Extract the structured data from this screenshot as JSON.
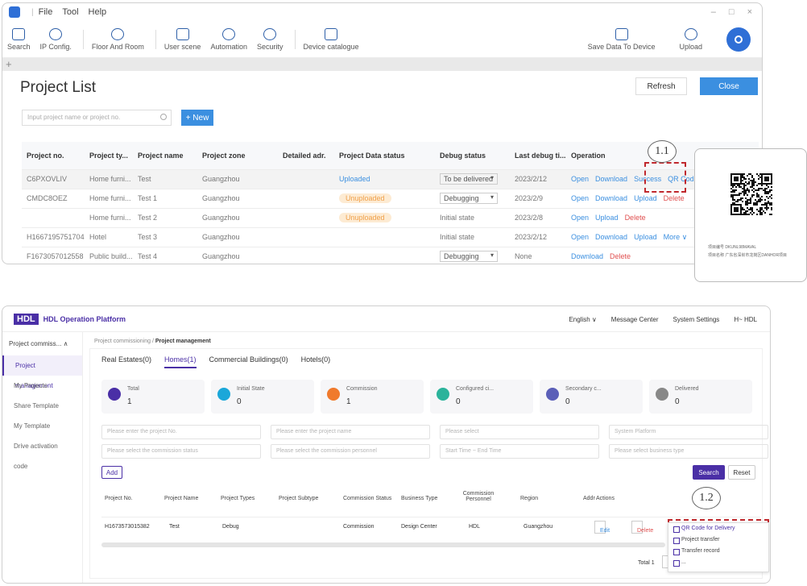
{
  "window1": {
    "menu": [
      "File",
      "Tool",
      "Help"
    ],
    "window_controls": [
      "–",
      "□",
      "×"
    ],
    "toolbar_left": [
      {
        "label": "Search",
        "icon": "search-icon"
      },
      {
        "label": "IP Config.",
        "icon": "ip-config-icon"
      },
      {
        "label": "Floor And Room",
        "icon": "floor-icon"
      },
      {
        "label": "User scene",
        "icon": "user-scene-icon"
      },
      {
        "label": "Automation",
        "icon": "automation-icon"
      },
      {
        "label": "Security",
        "icon": "security-icon"
      },
      {
        "label": "Device catalogue",
        "icon": "device-catalogue-icon"
      }
    ],
    "toolbar_right": [
      {
        "label": "Save Data To Device",
        "icon": "save-icon"
      },
      {
        "label": "Upload",
        "icon": "upload-icon"
      }
    ],
    "tab_plus": "+",
    "title": "Project List",
    "refresh": "Refresh",
    "close": "Close",
    "search_placeholder": "Input project name or project no.",
    "new_button": "+ New",
    "columns": [
      "Project no.",
      "Project ty...",
      "Project name",
      "Project zone",
      "Detailed adr.",
      "Project Data status",
      "Debug status",
      "Last debug ti...",
      "Operation"
    ],
    "rows": [
      {
        "no": "C6PXOVLIV",
        "type": "Home furni...",
        "name": "Test",
        "zone": "Guangzhou",
        "status": "Uploaded",
        "debug": "To be delivered",
        "debug_select": true,
        "last": "2023/2/12",
        "ops": [
          {
            "t": "Open",
            "k": "op"
          },
          {
            "t": "Download",
            "k": "op"
          },
          {
            "t": "Success",
            "k": "ok"
          },
          {
            "t": "QR Code",
            "k": "op"
          }
        ]
      },
      {
        "no": "CMDC8OEZ",
        "type": "Home furni...",
        "name": "Test 1",
        "zone": "Guangzhou",
        "status": "Unuploaded",
        "debug": "Debugging",
        "debug_select": true,
        "last": "2023/2/9",
        "ops": [
          {
            "t": "Open",
            "k": "op"
          },
          {
            "t": "Download",
            "k": "op"
          },
          {
            "t": "Upload",
            "k": "op"
          },
          {
            "t": "Delete",
            "k": "del"
          }
        ]
      },
      {
        "no": "",
        "type": "Home furni...",
        "name": "Test 2",
        "zone": "Guangzhou",
        "status": "Unuploaded",
        "debug": "Initial state",
        "debug_select": false,
        "last": "2023/2/8",
        "ops": [
          {
            "t": "Open",
            "k": "op"
          },
          {
            "t": "Upload",
            "k": "op"
          },
          {
            "t": "Delete",
            "k": "del"
          }
        ]
      },
      {
        "no": "H1667195751704",
        "type": "Hotel",
        "name": "Test 3",
        "zone": "Guangzhou",
        "status": "",
        "debug": "Initial state",
        "debug_select": false,
        "last": "2023/2/12",
        "ops": [
          {
            "t": "Open",
            "k": "op"
          },
          {
            "t": "Download",
            "k": "op"
          },
          {
            "t": "Upload",
            "k": "op"
          },
          {
            "t": "More ∨",
            "k": "op"
          }
        ]
      },
      {
        "no": "F1673057012558",
        "type": "Public build...",
        "name": "Test 4",
        "zone": "Guangzhou",
        "status": "",
        "debug": "Debugging",
        "debug_select": true,
        "last": "None",
        "ops": [
          {
            "t": "Download",
            "k": "op"
          },
          {
            "t": "Delete",
            "k": "del"
          }
        ]
      }
    ],
    "callout": "1.1",
    "qr_lines": [
      "项目编号  DKUNL98MAVAL",
      "项目名称  广东省深圳市龙岗区DANHOR项目"
    ]
  },
  "window2": {
    "logo": "HDL",
    "platform": "HDL Operation Platform",
    "lang": "English ∨",
    "message_center": "Message Center",
    "system_settings": "System Settings",
    "user": "H~ HDL",
    "sidebar_group": "Project commiss... ∧",
    "sidebar_items": [
      "Project management",
      "My Projects",
      "Share Template",
      "My Template",
      "Drive activation code"
    ],
    "breadcrumb_prefix": "Project commissioning  /",
    "breadcrumb_current": "Project management",
    "tabs": [
      "Real Estates(0)",
      "Homes(1)",
      "Commercial Buildings(0)",
      "Hotels(0)"
    ],
    "stats": [
      {
        "label": "Total",
        "value": "1",
        "color": "#4a2fa6"
      },
      {
        "label": "Initial State",
        "value": "0",
        "color": "#1ba7d9"
      },
      {
        "label": "Commission",
        "value": "1",
        "color": "#f07a2c"
      },
      {
        "label": "Configured ci...",
        "value": "0",
        "color": "#2bb39b"
      },
      {
        "label": "Secondary c...",
        "value": "0",
        "color": "#5b5fb8"
      },
      {
        "label": "Delivered",
        "value": "0",
        "color": "#888888"
      }
    ],
    "filters_row1": [
      "Please enter the project No.",
      "Please enter the project name",
      "Please select",
      "System Platform"
    ],
    "filters_row2": [
      "Please select the commission status",
      "Please select the commission personnel",
      "Start Time     ~  End Time",
      "Please select business type"
    ],
    "add": "Add",
    "search": "Search",
    "reset": "Reset",
    "headers": [
      "Project No.",
      "Project Name",
      "Project Types",
      "Project Subtype",
      "Commission Status",
      "Business Type",
      "Commission Personnel",
      "Region",
      "Addr",
      "Actions"
    ],
    "row": {
      "no": "H1673573015382",
      "name": "Test",
      "type": "Debug",
      "commission": "Commission",
      "business": "Design Center",
      "personnel": "HDL",
      "region": "Guangzhou",
      "edit": "Edit",
      "delete": "Delete"
    },
    "total": "Total 1",
    "callout": "1.2",
    "menu": [
      "QR Code for Delivery",
      "Project transfer",
      "Transfer record",
      "..."
    ]
  }
}
